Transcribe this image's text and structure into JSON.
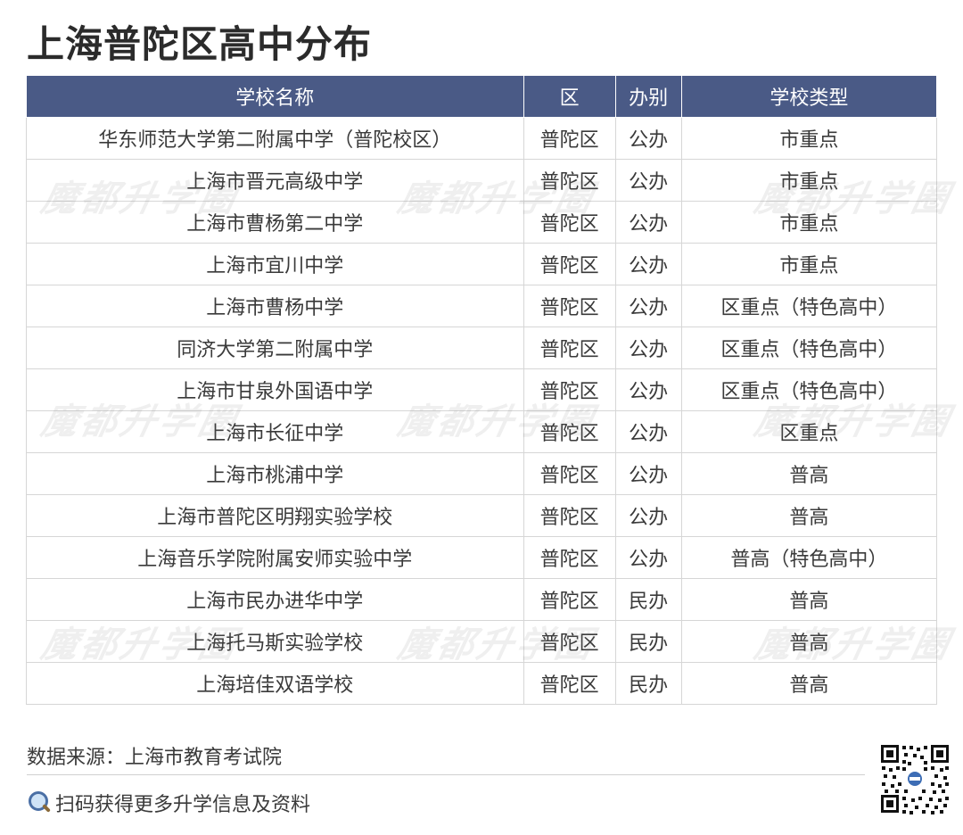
{
  "title": "上海普陀区高中分布",
  "table": {
    "headers": [
      "学校名称",
      "区",
      "办别",
      "学校类型"
    ],
    "rows": [
      [
        "华东师范大学第二附属中学（普陀校区）",
        "普陀区",
        "公办",
        "市重点"
      ],
      [
        "上海市晋元高级中学",
        "普陀区",
        "公办",
        "市重点"
      ],
      [
        "上海市曹杨第二中学",
        "普陀区",
        "公办",
        "市重点"
      ],
      [
        "上海市宜川中学",
        "普陀区",
        "公办",
        "市重点"
      ],
      [
        "上海市曹杨中学",
        "普陀区",
        "公办",
        "区重点（特色高中）"
      ],
      [
        "同济大学第二附属中学",
        "普陀区",
        "公办",
        "区重点（特色高中）"
      ],
      [
        "上海市甘泉外国语中学",
        "普陀区",
        "公办",
        "区重点（特色高中）"
      ],
      [
        "上海市长征中学",
        "普陀区",
        "公办",
        "区重点"
      ],
      [
        "上海市桃浦中学",
        "普陀区",
        "公办",
        "普高"
      ],
      [
        "上海市普陀区明翔实验学校",
        "普陀区",
        "公办",
        "普高"
      ],
      [
        "上海音乐学院附属安师实验中学",
        "普陀区",
        "公办",
        "普高（特色高中）"
      ],
      [
        "上海市民办进华中学",
        "普陀区",
        "民办",
        "普高"
      ],
      [
        "上海托马斯实验学校",
        "普陀区",
        "民办",
        "普高"
      ],
      [
        "上海培佳双语学校",
        "普陀区",
        "民办",
        "普高"
      ]
    ]
  },
  "watermark_text": "魔都升学圈",
  "footer": {
    "source": "数据来源：上海市教育考试院",
    "scan_text": "扫码获得更多升学信息及资料"
  },
  "icons": {
    "search": "magnifying-glass-icon",
    "qr": "qr-code-icon"
  },
  "colors": {
    "header_bg": "#4a5a86",
    "header_text": "#ffffff",
    "grid": "#d6d6d6"
  }
}
